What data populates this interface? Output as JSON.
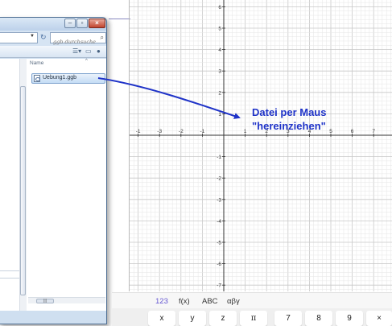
{
  "explorer": {
    "search_placeholder": "ggb durchsuchen",
    "column_header": "Name",
    "file_name": "Uebung1.ggb",
    "hscroll_thumb": "|||"
  },
  "annotation": {
    "line1": "Datei per Maus",
    "line2": "\"hereinziehen\""
  },
  "axes": {
    "x_ticks": [
      "-1",
      "-3",
      "-2",
      "-1",
      "1",
      "2",
      "3",
      "4",
      "5",
      "6",
      "7"
    ],
    "y_ticks": [
      "6",
      "5",
      "4",
      "3",
      "2",
      "1",
      "-1",
      "-2",
      "-3",
      "-4",
      "-5",
      "-6",
      "-7"
    ]
  },
  "keyboard": {
    "tabs": [
      "123",
      "f(x)",
      "ABC",
      "αβγ"
    ],
    "active_tab": "123",
    "keys": [
      "x",
      "y",
      "z",
      "π",
      "7",
      "8",
      "9",
      "×"
    ]
  },
  "colors": {
    "annotation": "#1f33c8",
    "active_tab": "#6557d2",
    "grid_minor": "#e6e6e6",
    "grid_major": "#c8c8c8"
  }
}
